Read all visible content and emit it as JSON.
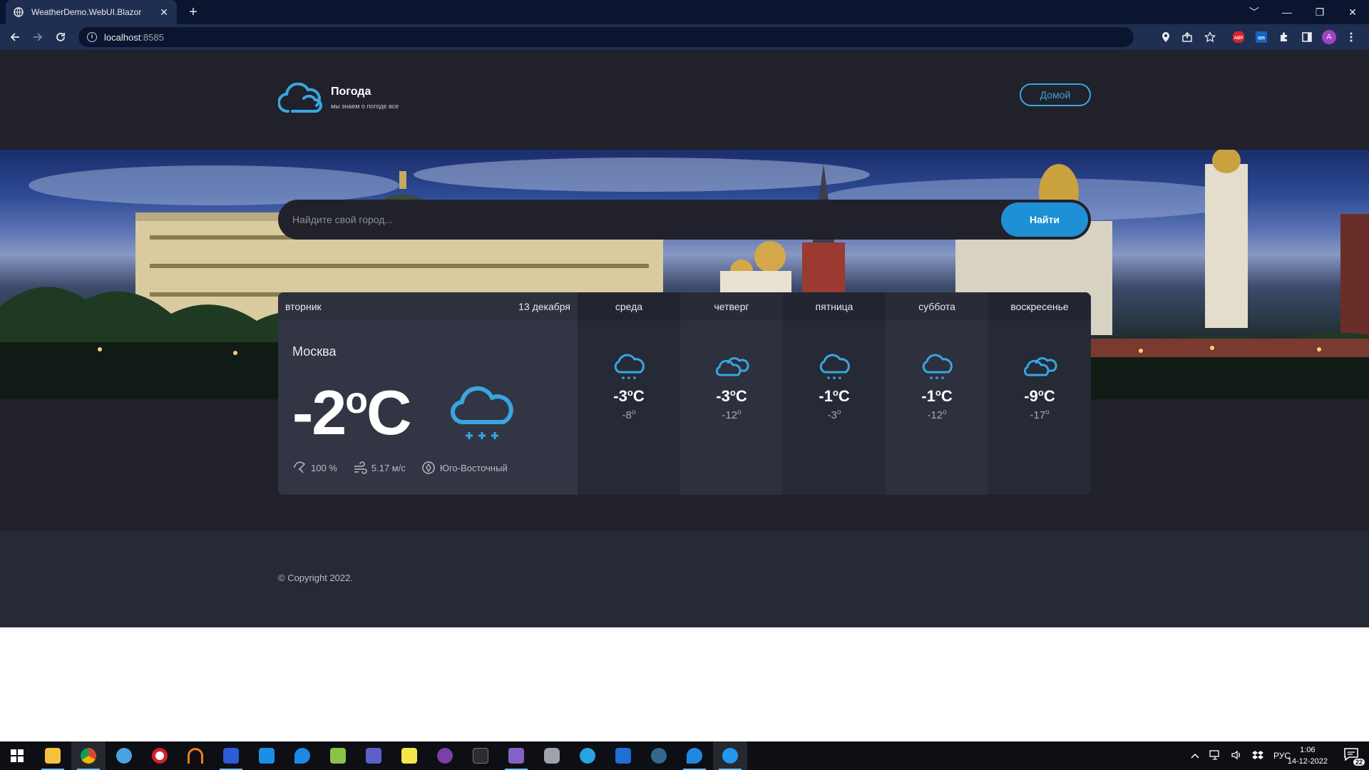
{
  "browser": {
    "tab_title": "WeatherDemo.WebUI.Blazor",
    "tab_close": "✕",
    "new_tab": "+",
    "url_host": "localhost",
    "url_port": ":8585",
    "window_controls": [
      "﹀",
      "—",
      "❐",
      "✕"
    ],
    "profile_initial": "A"
  },
  "header": {
    "brand_name": "Погода",
    "brand_sub": "мы знаем о погоде все",
    "home_button": "Домой"
  },
  "search": {
    "placeholder": "Найдите свой город...",
    "button": "Найти"
  },
  "today": {
    "weekday": "вторник",
    "date": "13 декабря",
    "city": "Москва",
    "temp": "-2",
    "unit": "C",
    "deg": "o",
    "humidity": "100 %",
    "wind_speed": "5.17 м/с",
    "wind_direction": "Юго-Восточный",
    "icon": "cloud-snow-icon"
  },
  "days": [
    {
      "name": "среда",
      "max": "-3",
      "min": "-8",
      "icon": "cloud-snow-icon"
    },
    {
      "name": "четверг",
      "max": "-3",
      "min": "-12",
      "icon": "cloudy-icon"
    },
    {
      "name": "пятница",
      "max": "-1",
      "min": "-3",
      "icon": "cloud-snow-icon"
    },
    {
      "name": "суббота",
      "max": "-1",
      "min": "-12",
      "icon": "cloud-snow-icon"
    },
    {
      "name": "воскресенье",
      "max": "-9",
      "min": "-17",
      "icon": "cloudy-icon"
    }
  ],
  "footer": {
    "copyright": "© Copyright 2022."
  },
  "taskbar": {
    "language": "РУС",
    "time": "1:06",
    "date": "14-12-2022",
    "notifications": "22"
  },
  "colors": {
    "accent": "#1e90d6",
    "icon_blue": "#38a6e0",
    "page_bg": "#20212b"
  }
}
